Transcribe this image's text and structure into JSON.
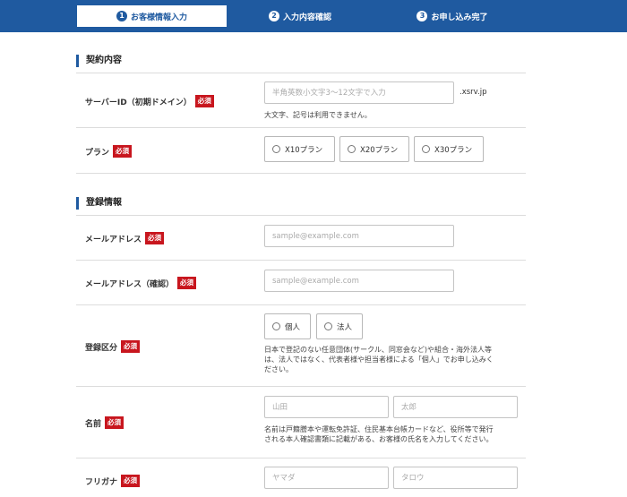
{
  "steps": [
    {
      "number": "1",
      "label": "お客様情報入力"
    },
    {
      "number": "2",
      "label": "入力内容確認"
    },
    {
      "number": "3",
      "label": "お申し込み完了"
    }
  ],
  "required_badge": "必須",
  "contract": {
    "title": "契約内容",
    "server_id": {
      "label": "サーバーID（初期ドメイン）",
      "placeholder": "半角英数小文字3〜12文字で入力",
      "suffix": ".xsrv.jp",
      "note": "大文字、記号は利用できません。"
    },
    "plan": {
      "label": "プラン",
      "options": [
        "X10プラン",
        "X20プラン",
        "X30プラン"
      ]
    }
  },
  "registration": {
    "title": "登録情報",
    "email": {
      "label": "メールアドレス",
      "placeholder": "sample@example.com"
    },
    "email_confirm": {
      "label": "メールアドレス（確認）",
      "placeholder": "sample@example.com"
    },
    "type": {
      "label": "登録区分",
      "options": [
        "個人",
        "法人"
      ],
      "note_lines": [
        "日本で登記のない任意団体(サークル、同窓会など)や組合・海外法人等",
        "は、法人ではなく、代表者様や担当者様による「個人」でお申し込みく",
        "ださい。"
      ]
    },
    "name": {
      "label": "名前",
      "last_placeholder": "山田",
      "first_placeholder": "太郎",
      "note_lines": [
        "名前は戸籍謄本や運転免許証、住民基本台帳カードなど、役所等で発行",
        "される本人確認書類に記載がある、お客様の氏名を入力してください。"
      ]
    },
    "furigana": {
      "label": "フリガナ",
      "last_placeholder": "ヤマダ",
      "first_placeholder": "タロウ"
    }
  }
}
